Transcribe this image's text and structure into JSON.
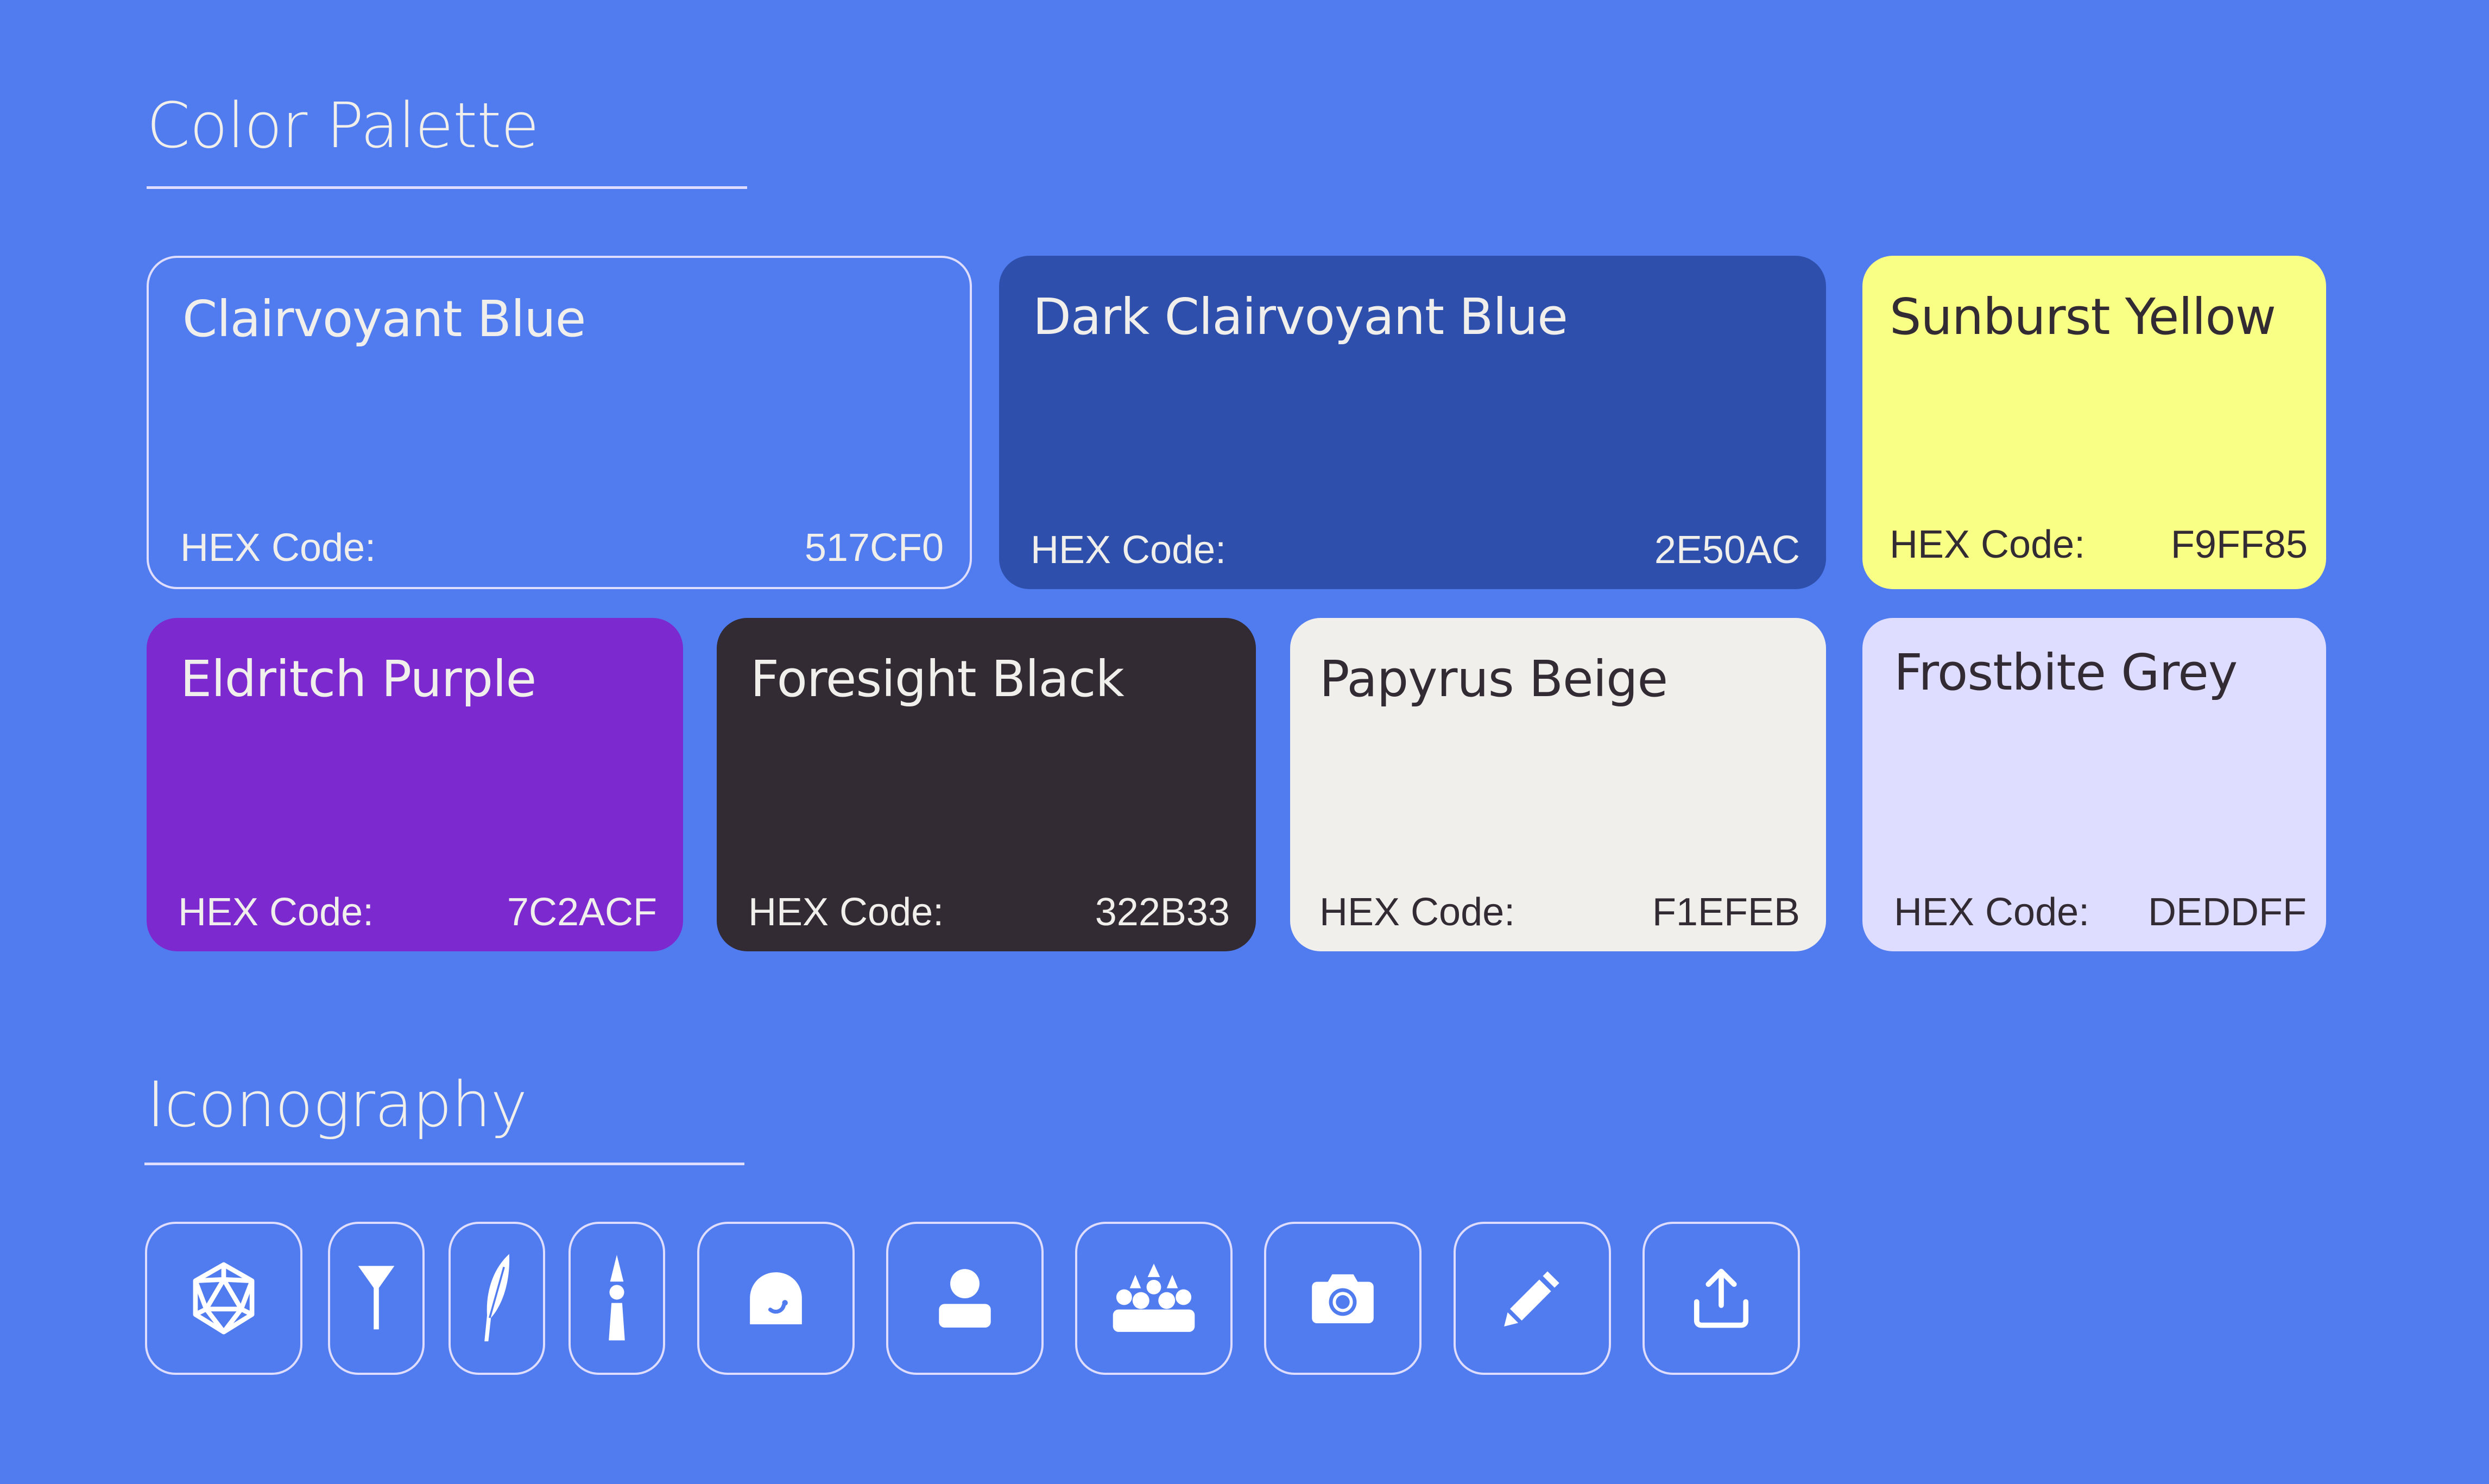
{
  "sections": {
    "palette_title": "Color Palette",
    "iconography_title": "Iconography"
  },
  "colors": [
    {
      "name": "Clairvoyant Blue",
      "hex_label": "HEX Code:",
      "hex": "517CF0",
      "swatch": "#517CF0",
      "text_color": "#F1EFEB"
    },
    {
      "name": "Dark Clairvoyant Blue",
      "hex_label": "HEX Code:",
      "hex": "2E50AC",
      "swatch": "#2E50AC",
      "text_color": "#F1EFEB"
    },
    {
      "name": "Sunburst Yellow",
      "hex_label": "HEX Code:",
      "hex": "F9FF85",
      "swatch": "#F9FF85",
      "text_color": "#322B33"
    },
    {
      "name": "Eldritch Purple",
      "hex_label": "HEX Code:",
      "hex": "7C2ACF",
      "swatch": "#7C2ACF",
      "text_color": "#F1EFEB"
    },
    {
      "name": "Foresight Black",
      "hex_label": "HEX Code:",
      "hex": "322B33",
      "swatch": "#322B33",
      "text_color": "#F1EFEB"
    },
    {
      "name": "Papyrus Beige",
      "hex_label": "HEX Code:",
      "hex": "F1EFEB",
      "swatch": "#F1EFEB",
      "text_color": "#322B33"
    },
    {
      "name": "Frostbite Grey",
      "hex_label": "HEX Code:",
      "hex": "DEDDFF",
      "swatch": "#DEDDFF",
      "text_color": "#322B33"
    }
  ],
  "icons": [
    "d20-dice-icon",
    "goblet-icon",
    "feather-quill-icon",
    "tower-icon",
    "character-head-icon",
    "user-icon",
    "group-icon",
    "camera-icon",
    "pencil-icon",
    "share-upload-icon"
  ]
}
